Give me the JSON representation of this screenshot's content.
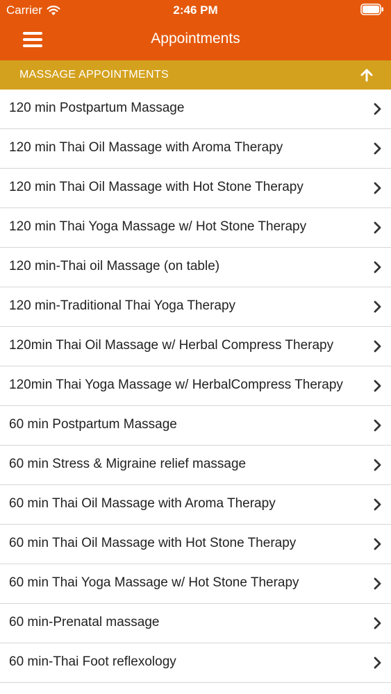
{
  "status_bar": {
    "carrier": "Carrier",
    "time": "2:46 PM",
    "icons": [
      "wifi-icon",
      "battery-icon"
    ]
  },
  "nav": {
    "title": "Appointments",
    "menu_icon": "hamburger-menu-icon"
  },
  "section": {
    "title": "MASSAGE APPOINTMENTS",
    "collapse_icon": "arrow-up-icon"
  },
  "colors": {
    "nav_background": "#e5580b",
    "section_background": "#d3a11d",
    "text": "#222222",
    "separator": "#d6d6d6"
  },
  "appointments": [
    "120 min Postpartum Massage",
    "120 min Thai Oil Massage with Aroma Therapy",
    "120 min Thai Oil Massage with Hot Stone Therapy",
    "120 min Thai Yoga Massage w/ Hot Stone Therapy",
    "120 min-Thai oil Massage (on table)",
    "120 min-Traditional Thai Yoga Therapy",
    "120min Thai Oil Massage w/ Herbal Compress Therapy",
    "120min Thai Yoga Massage w/ HerbalCompress Therapy",
    "60 min Postpartum Massage",
    "60 min Stress & Migraine relief massage",
    "60 min Thai Oil Massage with Aroma Therapy",
    "60 min Thai Oil Massage with Hot Stone Therapy",
    "60 min Thai Yoga Massage w/ Hot Stone Therapy",
    "60 min-Prenatal massage",
    "60 min-Thai Foot reflexology"
  ]
}
